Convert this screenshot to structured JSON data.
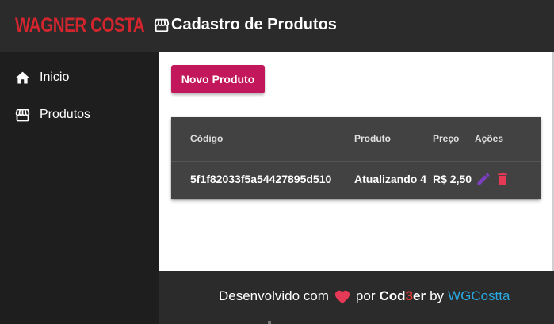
{
  "header": {
    "logo_text": "WAGNER COSTA",
    "page_icon": "store-icon",
    "page_title": "Cadastro de Produtos"
  },
  "sidebar": {
    "items": [
      {
        "label": "Inicio",
        "icon": "home-icon"
      },
      {
        "label": "Produtos",
        "icon": "store-icon"
      }
    ]
  },
  "main": {
    "new_button_label": "Novo Produto",
    "table": {
      "headers": [
        "Código",
        "Produto",
        "Preço",
        "Ações"
      ],
      "rows": [
        {
          "codigo": "5f1f82033f5a54427895d510",
          "produto": "Atualizando 4",
          "preco": "R$ 2,50",
          "actions": [
            "edit-icon",
            "delete-icon"
          ]
        }
      ]
    }
  },
  "footer": {
    "text_before": "Desenvolvido com",
    "heart_icon": "heart-icon",
    "text_por": "por",
    "brand_cod": "Cod",
    "brand_3": "3",
    "brand_er": "er",
    "text_by": "by",
    "link_text": "WGCostta"
  },
  "colors": {
    "logo": "#d3252e",
    "button": "#c2185b",
    "edit_icon": "#7b3fbf",
    "delete_icon": "#e53955",
    "heart": "#e53955",
    "link": "#29a8e0"
  }
}
